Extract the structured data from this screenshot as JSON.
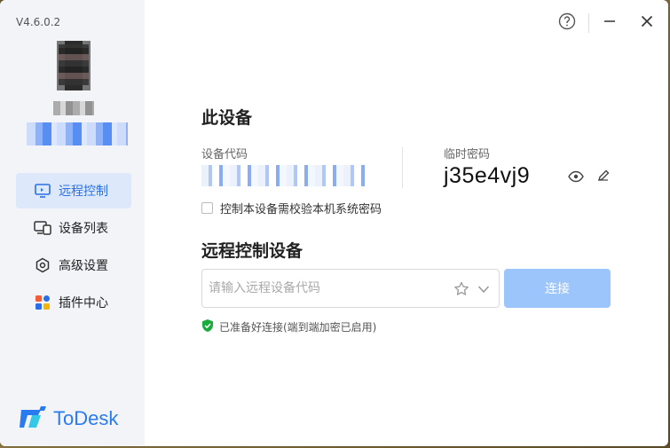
{
  "app": {
    "version": "V4.6.0.2",
    "brand": "ToDesk",
    "accent": "#2b6fe6",
    "brand_blue": "#2a7bf0"
  },
  "sidebar": {
    "items": [
      {
        "label": "远程控制",
        "icon": "remote-screen-icon",
        "active": true
      },
      {
        "label": "设备列表",
        "icon": "devices-icon",
        "active": false
      },
      {
        "label": "高级设置",
        "icon": "settings-icon",
        "active": false
      },
      {
        "label": "插件中心",
        "icon": "plugins-icon",
        "active": false
      }
    ]
  },
  "this_device": {
    "title": "此设备",
    "device_code_label": "设备代码",
    "temp_password_label": "临时密码",
    "temp_password": "j35e4vj9",
    "verify_checkbox_label": "控制本设备需校验本机系统密码"
  },
  "remote": {
    "title": "远程控制设备",
    "input_placeholder": "请输入远程设备代码",
    "connect_label": "连接",
    "connect_color": "#9cc5fb",
    "status_text": "已准备好连接(端到端加密已启用)",
    "status_color": "#1aab3c"
  }
}
